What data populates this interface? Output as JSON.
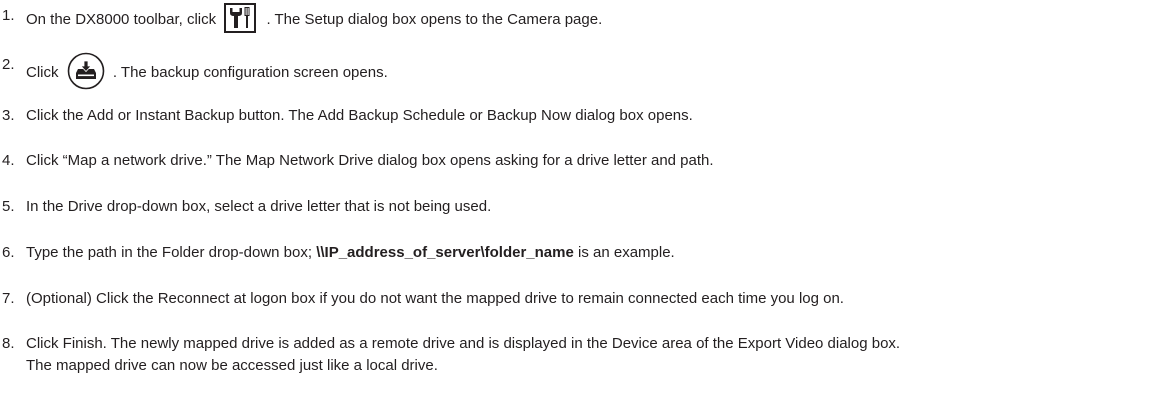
{
  "steps": [
    {
      "number": "1.",
      "before": "On the DX8000 toolbar, click",
      "icon": "setup-tools-icon",
      "after": ". The Setup dialog box opens to the Camera page."
    },
    {
      "number": "2.",
      "before": "Click",
      "icon": "backup-icon",
      "after": ". The backup configuration screen opens."
    },
    {
      "number": "3.",
      "text": "Click the Add or Instant Backup button. The Add Backup Schedule or Backup Now dialog box opens."
    },
    {
      "number": "4.",
      "text": "Click “Map a network drive.” The Map Network Drive dialog box opens asking for a drive letter and path."
    },
    {
      "number": "5.",
      "text": "In the Drive drop-down box, select a drive letter that is not being used."
    },
    {
      "number": "6.",
      "before": "Type the path in the Folder drop-down box; ",
      "bold": "\\\\IP_address_of_server\\folder_name",
      "after": " is an example."
    },
    {
      "number": "7.",
      "text": "(Optional) Click the Reconnect at logon box if you do not want the mapped drive to remain connected each time you log on."
    },
    {
      "number": "8.",
      "line1": "Click Finish. The newly mapped drive is added as a remote drive and is displayed in the Device area of the Export Video dialog box.",
      "line2": "The mapped drive can now be accessed just like a local drive."
    }
  ]
}
